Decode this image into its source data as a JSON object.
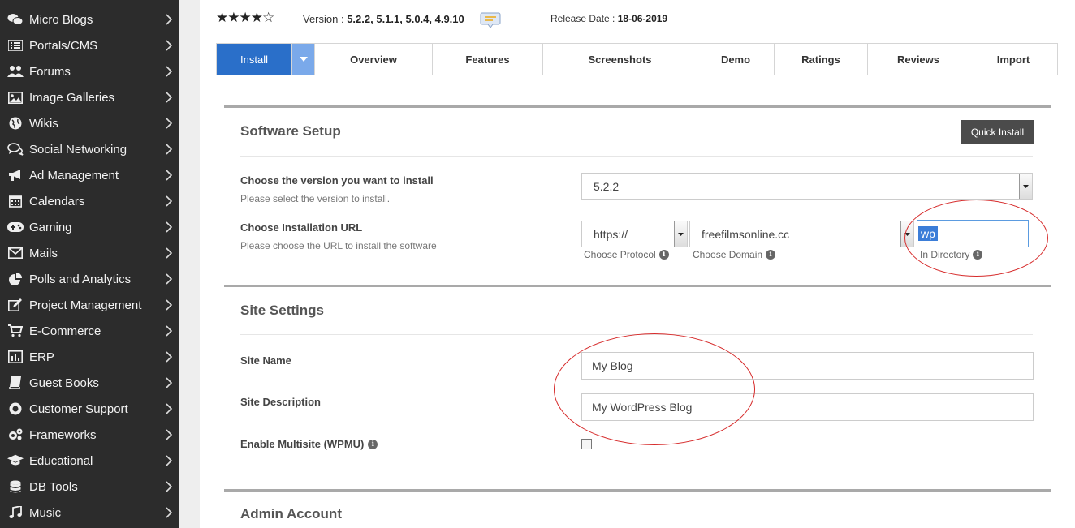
{
  "sidebar": {
    "items": [
      {
        "label": "Micro Blogs",
        "icon": "chat-bubbles-icon"
      },
      {
        "label": "Portals/CMS",
        "icon": "list-icon"
      },
      {
        "label": "Forums",
        "icon": "users-icon"
      },
      {
        "label": "Image Galleries",
        "icon": "image-icon"
      },
      {
        "label": "Wikis",
        "icon": "globe-icon"
      },
      {
        "label": "Social Networking",
        "icon": "comments-icon"
      },
      {
        "label": "Ad Management",
        "icon": "bullhorn-icon"
      },
      {
        "label": "Calendars",
        "icon": "calendar-icon"
      },
      {
        "label": "Gaming",
        "icon": "gamepad-icon"
      },
      {
        "label": "Mails",
        "icon": "envelope-icon"
      },
      {
        "label": "Polls and Analytics",
        "icon": "pie-chart-icon"
      },
      {
        "label": "Project Management",
        "icon": "edit-icon"
      },
      {
        "label": "E-Commerce",
        "icon": "cart-icon"
      },
      {
        "label": "ERP",
        "icon": "bar-chart-icon"
      },
      {
        "label": "Guest Books",
        "icon": "book-icon"
      },
      {
        "label": "Customer Support",
        "icon": "life-ring-icon"
      },
      {
        "label": "Frameworks",
        "icon": "cogs-icon"
      },
      {
        "label": "Educational",
        "icon": "graduation-cap-icon"
      },
      {
        "label": "DB Tools",
        "icon": "database-icon"
      },
      {
        "label": "Music",
        "icon": "music-icon"
      }
    ]
  },
  "header": {
    "stars": "★★★★☆",
    "rating_value": 4.5,
    "version_label": "Version : ",
    "versions": "5.2.2, 5.1.1, 5.0.4, 4.9.10",
    "release_label": "Release Date : ",
    "release_date": "18-06-2019"
  },
  "tabs": [
    "Install",
    "Overview",
    "Features",
    "Screenshots",
    "Demo",
    "Ratings",
    "Reviews",
    "Import"
  ],
  "software_setup": {
    "title": "Software Setup",
    "quick_install": "Quick Install",
    "version_label": "Choose the version you want to install",
    "version_sub": "Please select the version to install.",
    "version_value": "5.2.2",
    "url_label": "Choose Installation URL",
    "url_sub": "Please choose the URL to install the software",
    "protocol_value": "https://",
    "protocol_hint": "Choose Protocol",
    "domain_value": "freefilmsonline.cc",
    "domain_hint": "Choose Domain",
    "directory_value": "wp",
    "directory_hint": "In Directory"
  },
  "site_settings": {
    "title": "Site Settings",
    "name_label": "Site Name",
    "name_value": "My Blog",
    "desc_label": "Site Description",
    "desc_value": "My WordPress Blog",
    "multisite_label": "Enable Multisite (WPMU)",
    "multisite_checked": false
  },
  "admin_account": {
    "title": "Admin Account"
  },
  "colors": {
    "active_tab": "#2a6fc9",
    "sidebar_bg": "#2c2c2c",
    "annotation": "#d62a2a"
  }
}
